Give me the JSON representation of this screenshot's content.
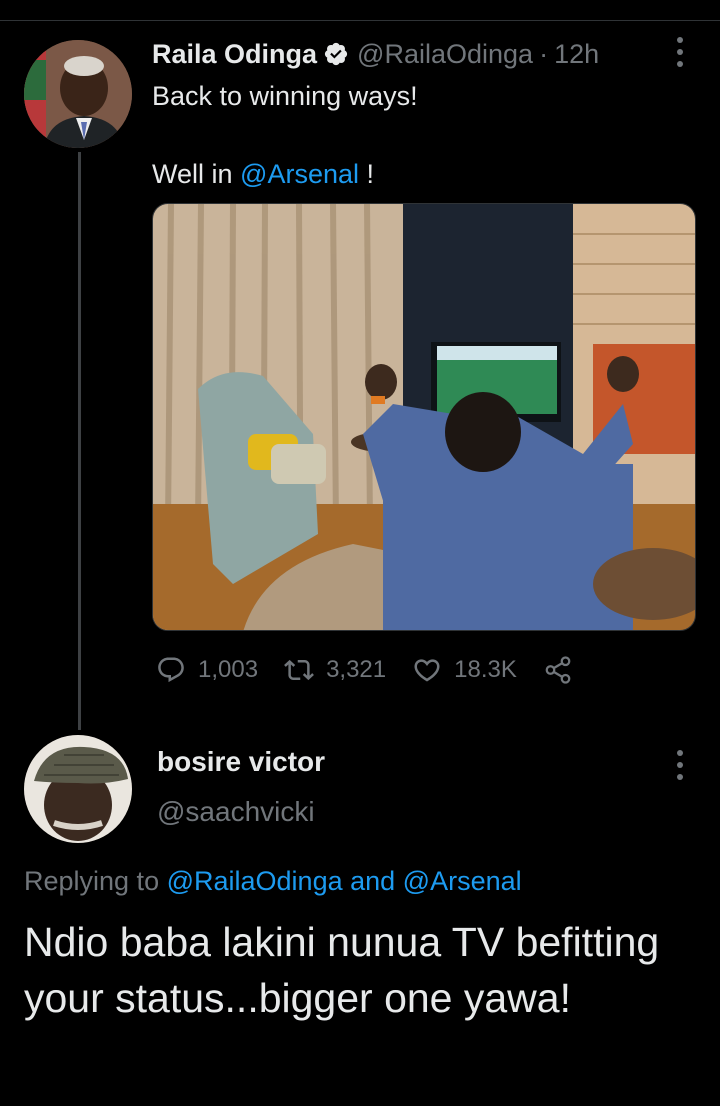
{
  "tweet": {
    "author_name": "Raila Odinga",
    "author_handle": "@RailaOdinga",
    "separator": "·",
    "time": "12h",
    "text_line1": "Back to winning ways!",
    "text_line2_prefix": "Well in ",
    "text_line2_mention": "@Arsenal",
    "text_line2_suffix": " !",
    "media_description": "photo-man-cheering-in-front-of-tv",
    "stats": {
      "replies": "1,003",
      "retweets": "3,321",
      "likes": "18.3K"
    }
  },
  "reply": {
    "author_name": "bosire victor",
    "author_handle": "@saachvicki",
    "replying_prefix": "Replying to ",
    "replying_mention1": "@RailaOdinga",
    "replying_and": " and ",
    "replying_mention2": "@Arsenal",
    "text": "Ndio baba lakini nunua TV befitting your status...bigger one yawa!"
  },
  "colors": {
    "background": "#000000",
    "text": "#e7e9ea",
    "muted": "#71767b",
    "link": "#1d9bf0",
    "verified": "#e7e9ea"
  },
  "icons": [
    "verified-badge-icon",
    "more-options-icon",
    "reply-icon",
    "retweet-icon",
    "like-icon",
    "share-icon"
  ]
}
